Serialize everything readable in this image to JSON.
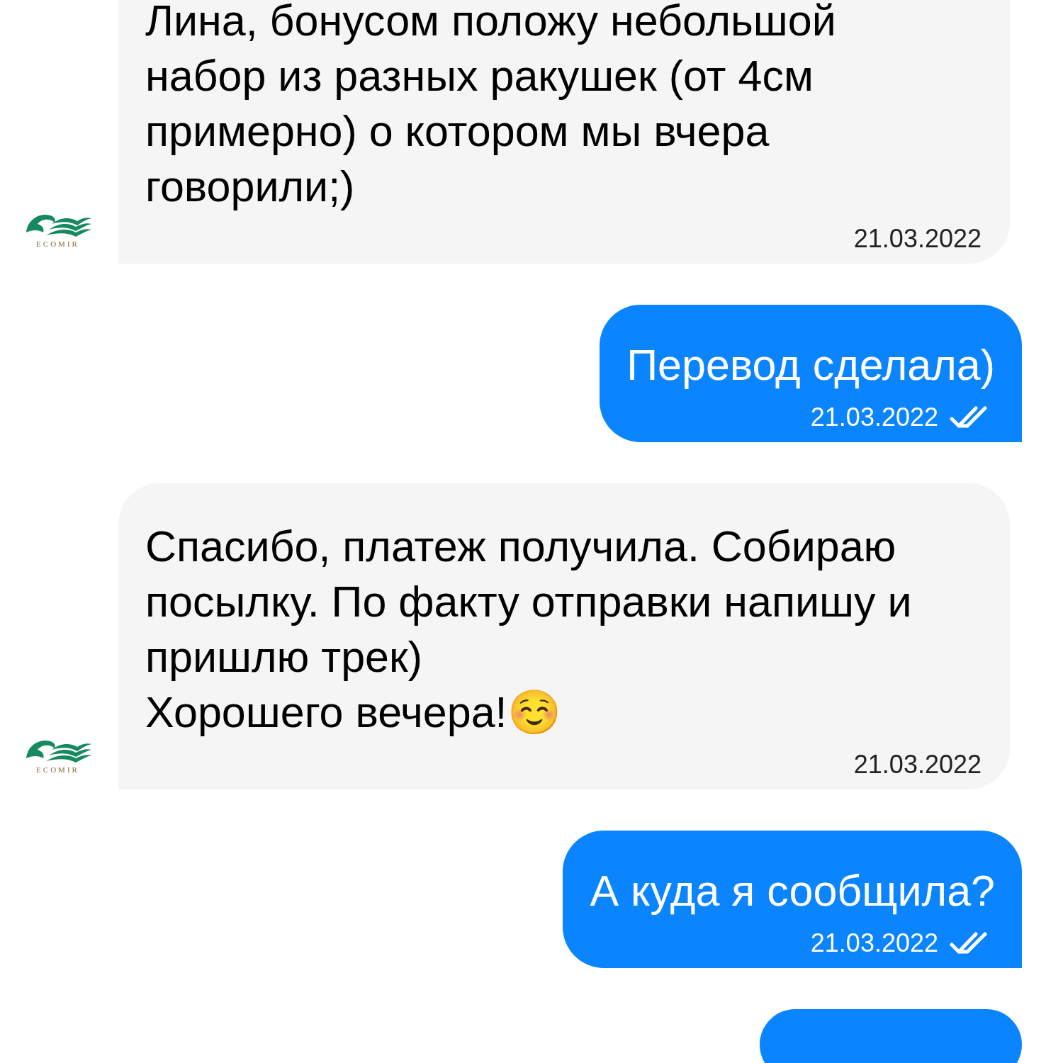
{
  "messages": [
    {
      "kind": "incoming",
      "text": "Лина, бонусом положу небольшой набор из разных ракушек (от 4см примерно) о котором мы вчера говорили;)",
      "time": "21.03.2022",
      "avatar_label": "ECOMIR",
      "cut_top": true
    },
    {
      "kind": "outgoing",
      "text": "Перевод сделала)",
      "time": "21.03.2022",
      "read": true,
      "cut_bottom": false
    },
    {
      "kind": "incoming",
      "text": "Спасибо, платеж получила. Собираю посылку. По факту отправки напишу и пришлю трек)\nХорошего вечера!☺️",
      "time": "21.03.2022",
      "avatar_label": "ECOMIR",
      "cut_top": false
    },
    {
      "kind": "outgoing",
      "text": "А куда я сообщила?",
      "time": "21.03.2022",
      "read": true,
      "cut_bottom": false
    },
    {
      "kind": "outgoing",
      "cut_bottom": true
    }
  ]
}
